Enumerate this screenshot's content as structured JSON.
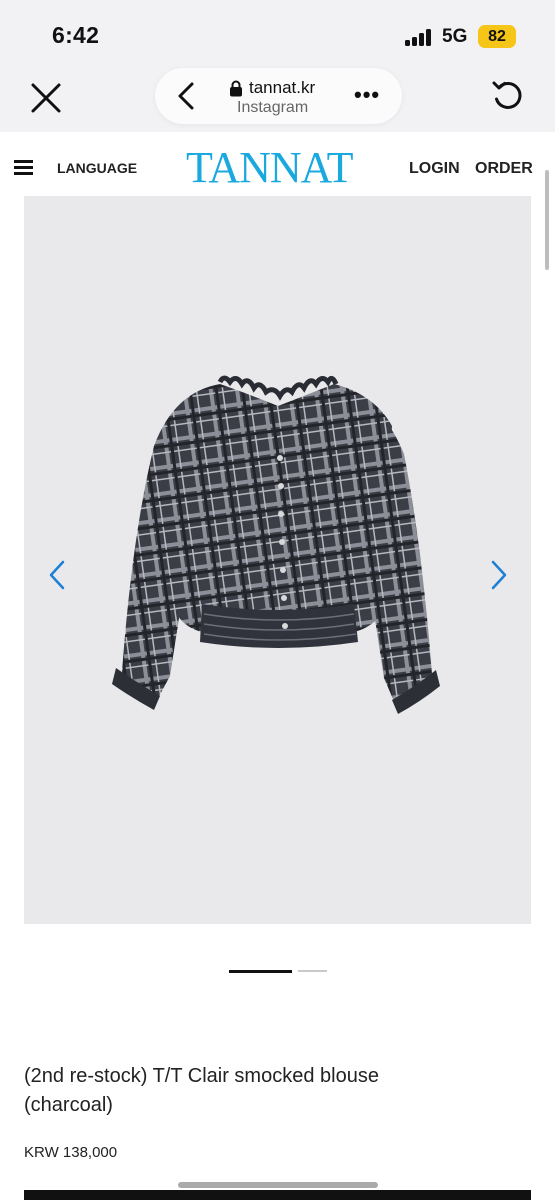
{
  "status_bar": {
    "time": "6:42",
    "network": "5G",
    "battery": "82",
    "battery_color": "#f5c518"
  },
  "browser": {
    "url": "tannat.kr",
    "subtitle": "Instagram",
    "more_label": "•••",
    "icons": [
      "close-icon",
      "back-icon",
      "lock-icon",
      "more-icon",
      "reload-icon"
    ]
  },
  "site_header": {
    "language_label": "LANGUAGE",
    "logo_text": "TANNAT",
    "logo_color": "#1aa9df",
    "login_label": "LOGIN",
    "order_label": "ORDER"
  },
  "carousel": {
    "arrow_color": "#1a7fd6",
    "image_description_icon": "plaid-blouse-photo"
  },
  "product": {
    "title": "(2nd re-stock) T/T Clair smocked blouse (charcoal)",
    "price": "KRW 138,000"
  }
}
